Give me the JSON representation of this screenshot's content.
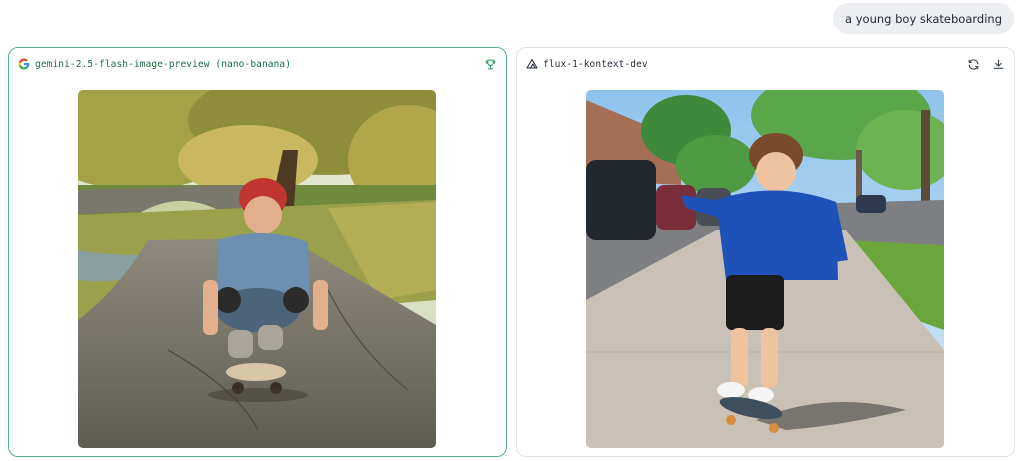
{
  "prompt": {
    "text": "a young boy skateboarding"
  },
  "panels": [
    {
      "model_name": "gemini-2.5-flash-image-preview (nano-banana)",
      "logo_icon": "google-g-icon",
      "actions": [
        "trophy-icon"
      ],
      "winner": true,
      "border_color": "#55b486"
    },
    {
      "model_name": "flux-1-kontext-dev",
      "logo_icon": "triangle-logo-icon",
      "actions": [
        "refresh-icon",
        "download-icon"
      ],
      "winner": false,
      "border_color": "#dfe2e7"
    }
  ]
}
